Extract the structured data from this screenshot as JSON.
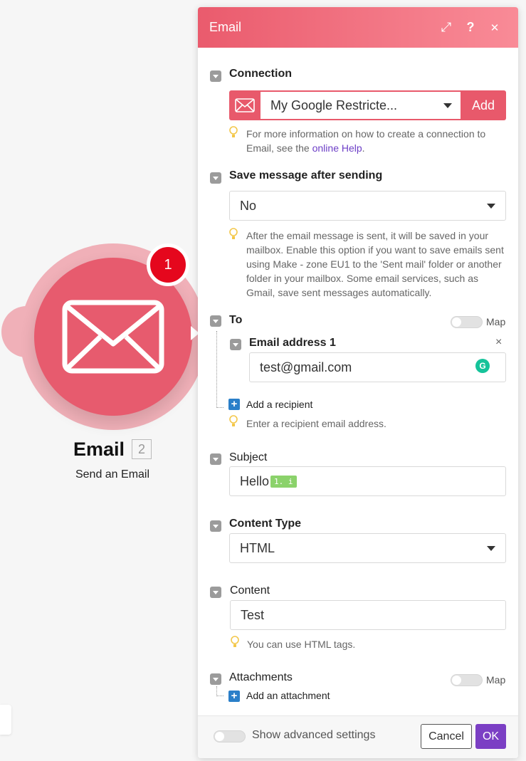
{
  "module": {
    "badge_count": "1",
    "title": "Email",
    "number": "2",
    "subtitle": "Send an Email",
    "icon": "envelope-icon",
    "brand_color": "#e75b6e"
  },
  "panel": {
    "title": "Email",
    "header_icons": [
      "expand-icon",
      "help-icon",
      "close-icon"
    ],
    "header_glyphs": {
      "expand": "⤢",
      "help": "?",
      "close": "✕"
    }
  },
  "connection": {
    "label": "Connection",
    "selected": "My Google Restricte...",
    "add_label": "Add",
    "hint_prefix": "For more information on how to create a connection to Email, see the",
    "hint_link": "online Help",
    "hint_suffix": "."
  },
  "save_message": {
    "label": "Save message after sending",
    "value": "No",
    "hint": "After the email message is sent, it will be saved in your mailbox. Enable this option if you want to save emails sent using Make - zone EU1 to the 'Sent mail' folder or another folder in your mailbox. Some email services, such as Gmail, save sent messages automatically."
  },
  "to": {
    "label": "To",
    "map_label": "Map",
    "item_label": "Email address 1",
    "remove_glyph": "×",
    "value": "test@gmail.com",
    "add_label": "Add a recipient",
    "hint": "Enter a recipient email address."
  },
  "subject": {
    "label": "Subject",
    "text": "Hello",
    "mapped_chip": "1. i"
  },
  "content_type": {
    "label": "Content Type",
    "value": "HTML"
  },
  "content": {
    "label": "Content",
    "value": "Test",
    "hint": "You can use HTML tags."
  },
  "attachments": {
    "label": "Attachments",
    "map_label": "Map",
    "add_label": "Add an attachment"
  },
  "footer": {
    "advanced_label": "Show advanced settings",
    "cancel_label": "Cancel",
    "ok_label": "OK"
  }
}
